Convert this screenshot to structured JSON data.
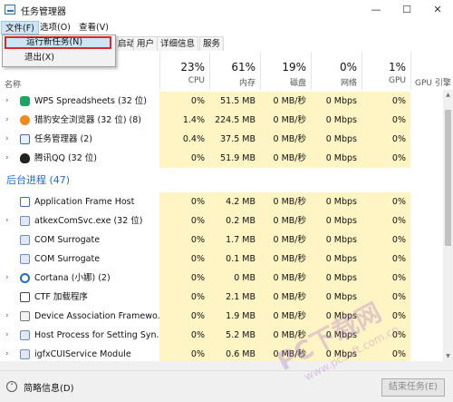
{
  "window": {
    "title": "任务管理器",
    "minimize": "—",
    "maximize": "☐",
    "close": "✕"
  },
  "menu": {
    "file": "文件(F)",
    "options": "选项(O)",
    "view": "查看(V)"
  },
  "file_menu": {
    "run_new_task": "运行新任务(N)",
    "exit": "退出(X)"
  },
  "tabs": [
    "启动",
    "用户",
    "详细信息",
    "服务"
  ],
  "columns": {
    "name": "名称",
    "cpu": {
      "percent": "23%",
      "label": "CPU"
    },
    "memory": {
      "percent": "61%",
      "label": "内存"
    },
    "disk": {
      "percent": "19%",
      "label": "磁盘"
    },
    "network": {
      "percent": "0%",
      "label": "网络"
    },
    "gpu": {
      "percent": "1%",
      "label": "GPU"
    },
    "gpu_engine": {
      "label": "GPU 引擎"
    }
  },
  "apps": [
    {
      "name": "WPS Spreadsheets (32 位)",
      "cpu": "0%",
      "memory": "51.5 MB",
      "disk": "0 MB/秒",
      "network": "0 Mbps",
      "gpu": "0%",
      "icon": "wps-spreadsheet-icon"
    },
    {
      "name": "猎豹安全浏览器 (32 位) (8)",
      "cpu": "1.4%",
      "memory": "224.5 MB",
      "disk": "0 MB/秒",
      "network": "0 Mbps",
      "gpu": "0%",
      "icon": "liebao-browser-icon"
    },
    {
      "name": "任务管理器 (2)",
      "cpu": "0.4%",
      "memory": "37.5 MB",
      "disk": "0 MB/秒",
      "network": "0 Mbps",
      "gpu": "0%",
      "icon": "task-manager-icon"
    },
    {
      "name": "腾讯QQ (32 位)",
      "cpu": "0%",
      "memory": "51.9 MB",
      "disk": "0 MB/秒",
      "network": "0 Mbps",
      "gpu": "0%",
      "icon": "qq-penguin-icon"
    }
  ],
  "background_section": "后台进程 (47)",
  "background": [
    {
      "name": "Application Frame Host",
      "cpu": "0%",
      "memory": "4.2 MB",
      "disk": "0 MB/秒",
      "network": "0 Mbps",
      "gpu": "0%",
      "icon": "app-frame-icon"
    },
    {
      "name": "atkexComSvc.exe (32 位)",
      "cpu": "0%",
      "memory": "0.2 MB",
      "disk": "0 MB/秒",
      "network": "0 Mbps",
      "gpu": "0%",
      "icon": "service-icon"
    },
    {
      "name": "COM Surrogate",
      "cpu": "0%",
      "memory": "1.7 MB",
      "disk": "0 MB/秒",
      "network": "0 Mbps",
      "gpu": "0%",
      "icon": "service-icon"
    },
    {
      "name": "COM Surrogate",
      "cpu": "0%",
      "memory": "0.1 MB",
      "disk": "0 MB/秒",
      "network": "0 Mbps",
      "gpu": "0%",
      "icon": "service-icon"
    },
    {
      "name": "Cortana (小娜) (2)",
      "cpu": "0%",
      "memory": "0 MB",
      "disk": "0 MB/秒",
      "network": "0 Mbps",
      "gpu": "0%",
      "icon": "cortana-icon"
    },
    {
      "name": "CTF 加载程序",
      "cpu": "0%",
      "memory": "2.1 MB",
      "disk": "0 MB/秒",
      "network": "0 Mbps",
      "gpu": "0%",
      "icon": "ctf-pen-icon"
    },
    {
      "name": "Device Association Framewo...",
      "cpu": "0%",
      "memory": "1.9 MB",
      "disk": "0 MB/秒",
      "network": "0 Mbps",
      "gpu": "0%",
      "icon": "device-icon"
    },
    {
      "name": "Host Process for Setting Syn...",
      "cpu": "0%",
      "memory": "5.2 MB",
      "disk": "0 MB/秒",
      "network": "0 Mbps",
      "gpu": "0%",
      "icon": "service-icon"
    },
    {
      "name": "igfxCUIService Module",
      "cpu": "0%",
      "memory": "0.6 MB",
      "disk": "0 MB/秒",
      "network": "0 Mbps",
      "gpu": "0%",
      "icon": "service-icon"
    }
  ],
  "footer": {
    "fewer_details": "简略信息(D)",
    "end_task": "结束任务(E)"
  },
  "watermark": {
    "main": "PC下载网",
    "url": "www.pcsoft.com.cn"
  },
  "colors": {
    "highlight": "#fff4c4",
    "selected_menu": "#cce4f7",
    "section": "#1e6ec8",
    "callout": "#e0262b"
  }
}
